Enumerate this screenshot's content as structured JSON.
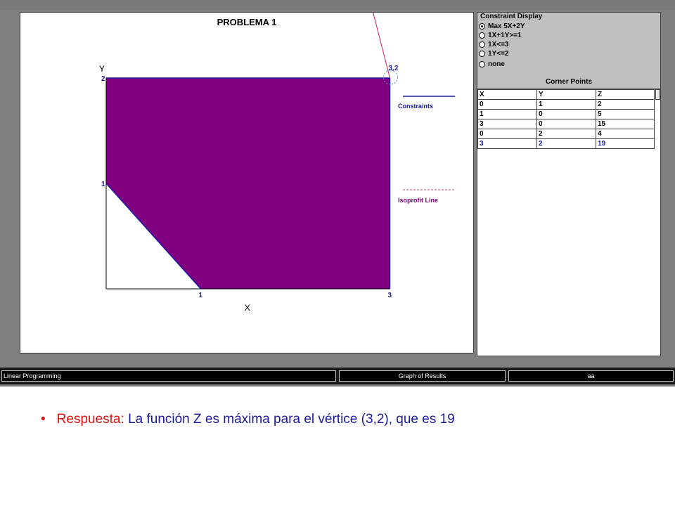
{
  "colors": {
    "feasible_region": "#800080",
    "constraint_lines": "#1a1aa8",
    "objective_line": "#cc2060",
    "isoprofit_line": "#c0407a",
    "corner_highlight": "#3a9fd0",
    "answer_label": "#e01010",
    "answer_text": "#1a1a9a"
  },
  "graph": {
    "title": "PROBLEMA 1",
    "x_axis_label": "X",
    "y_axis_label": "Y",
    "tick_labels": {
      "x1": "1",
      "x3": "3",
      "y1": "1",
      "y2": "2"
    },
    "corner_label": "3,2",
    "legend": {
      "constraints_label": "Constraints",
      "isoprofit_label": "Isoprofit Line"
    }
  },
  "constraint_display": {
    "title": "Constraint Display",
    "options": [
      {
        "label": "Max 5X+2Y",
        "selected": true
      },
      {
        "label": "1X+1Y>=1",
        "selected": false
      },
      {
        "label": "1X<=3",
        "selected": false
      },
      {
        "label": "1Y<=2",
        "selected": false
      },
      {
        "label": "none",
        "selected": false
      }
    ]
  },
  "corner_points": {
    "title": "Corner Points",
    "headers": [
      "X",
      "Y",
      "Z"
    ],
    "rows": [
      [
        "0",
        "1",
        "2"
      ],
      [
        "1",
        "0",
        "5"
      ],
      [
        "3",
        "0",
        "15"
      ],
      [
        "0",
        "2",
        "4"
      ],
      [
        "3",
        "2",
        "19"
      ]
    ]
  },
  "chart_data": {
    "type": "area",
    "title": "PROBLEMA 1",
    "xlabel": "X",
    "ylabel": "Y",
    "objective": "Max 5X+2Y",
    "constraints": [
      "1X+1Y>=1",
      "1X<=3",
      "1Y<=2"
    ],
    "feasible_region_vertices": [
      [
        0,
        1
      ],
      [
        1,
        0
      ],
      [
        3,
        0
      ],
      [
        3,
        2
      ],
      [
        0,
        2
      ]
    ],
    "optimal_point": [
      3,
      2
    ],
    "optimal_value": 19,
    "x_ticks": [
      "1",
      "3"
    ],
    "y_ticks": [
      "1",
      "2"
    ],
    "xlim": [
      0,
      3
    ],
    "ylim": [
      0,
      2
    ]
  },
  "statusbar": {
    "left": "Linear Programming",
    "middle": "Graph of Results",
    "right": "aa"
  },
  "answer": {
    "bullet": "•",
    "label": "Respuesta:",
    "text": "La función Z es máxima para el vértice (3,2), que es 19"
  }
}
